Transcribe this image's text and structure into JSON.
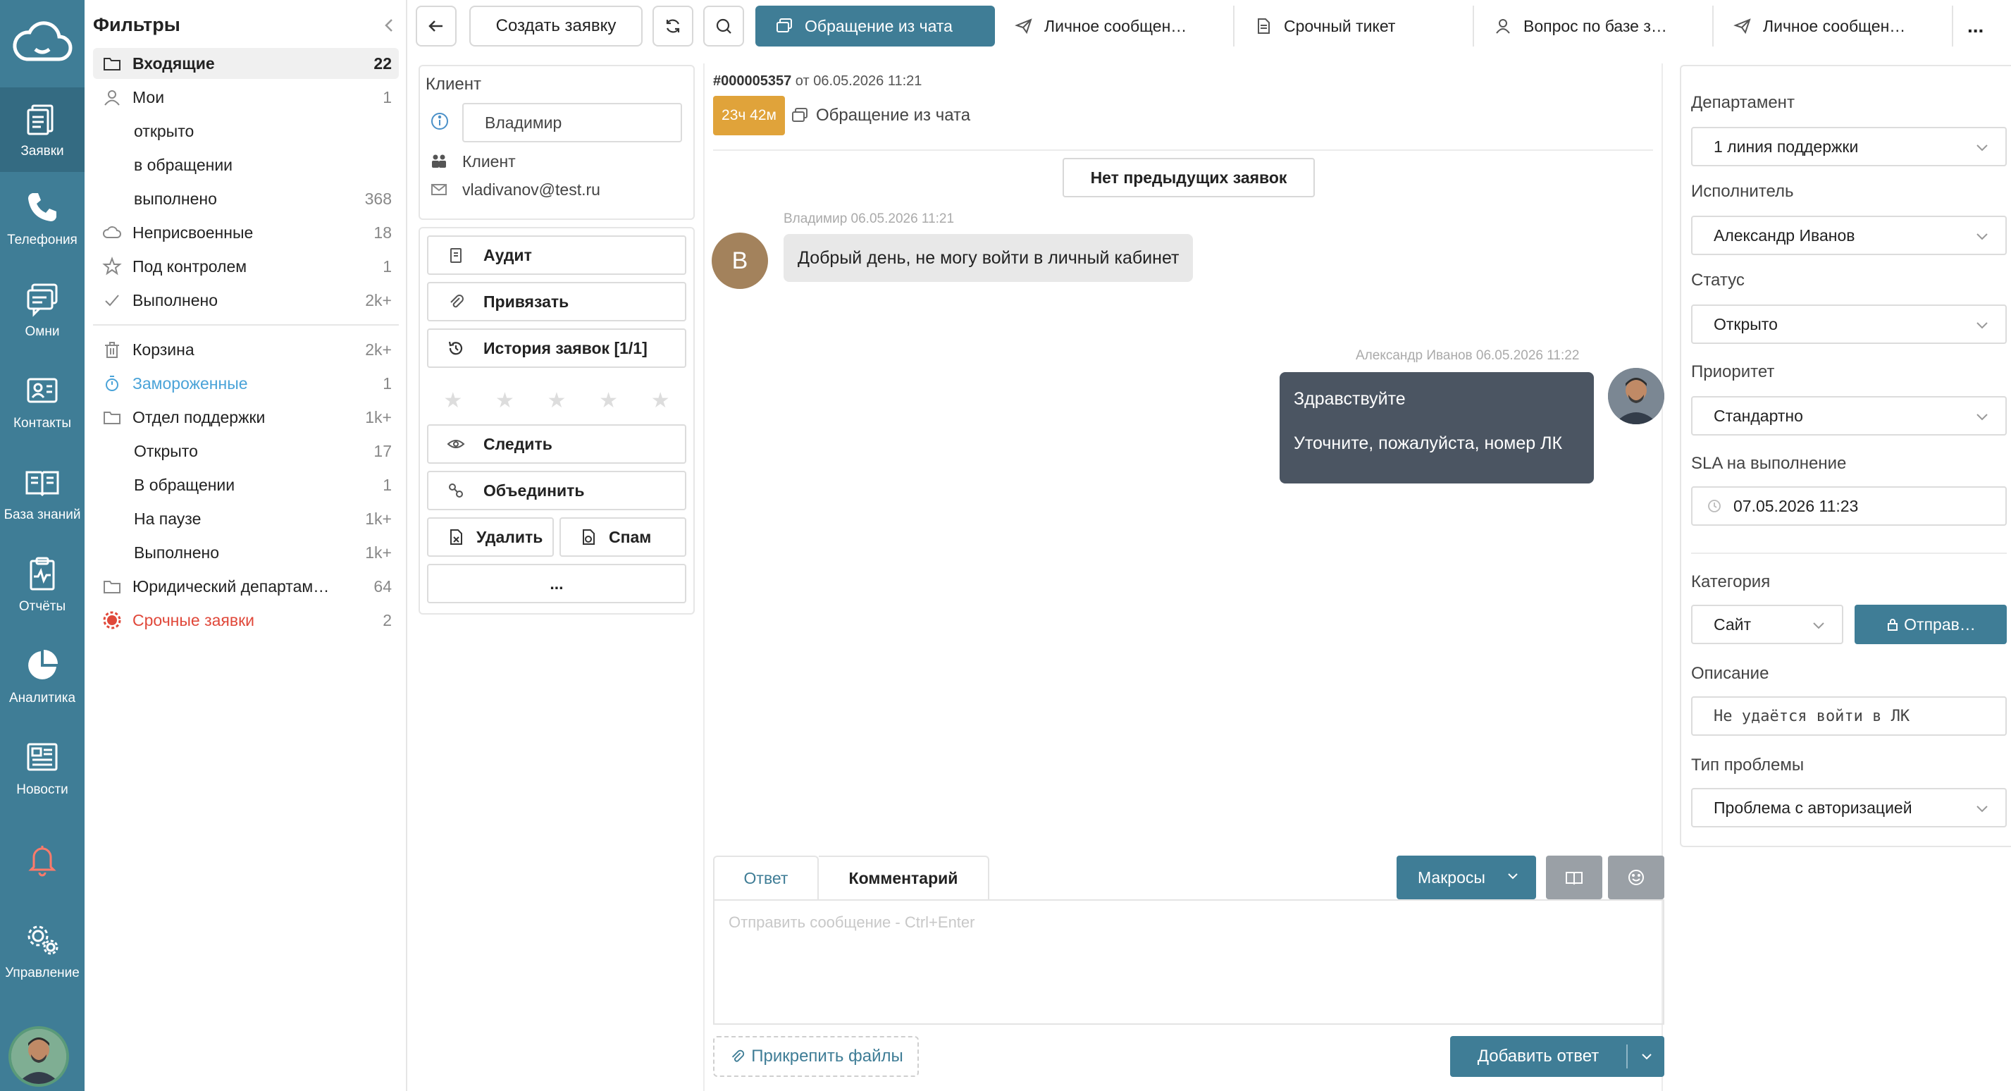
{
  "nav": {
    "items": [
      {
        "label": "Заявки",
        "icon": "tickets-icon"
      },
      {
        "label": "Телефония",
        "icon": "phone-icon"
      },
      {
        "label": "Омни",
        "icon": "omni-chat-icon"
      },
      {
        "label": "Контакты",
        "icon": "contacts-icon"
      },
      {
        "label": "База знаний",
        "icon": "knowledge-base-icon"
      },
      {
        "label": "Отчёты",
        "icon": "reports-icon"
      },
      {
        "label": "Аналитика",
        "icon": "analytics-icon"
      },
      {
        "label": "Новости",
        "icon": "news-icon"
      },
      {
        "label": "",
        "icon": "bell-icon"
      },
      {
        "label": "Управление",
        "icon": "settings-gears-icon"
      }
    ]
  },
  "filters": {
    "title": "Фильтры",
    "rows": [
      {
        "label": "Входящие",
        "count": "22"
      },
      {
        "label": "Мои",
        "count": "1"
      },
      {
        "label": "открыто",
        "count": ""
      },
      {
        "label": "в обращении",
        "count": ""
      },
      {
        "label": "выполнено",
        "count": "368"
      },
      {
        "label": "Неприсвоенные",
        "count": "18"
      },
      {
        "label": "Под контролем",
        "count": "1"
      },
      {
        "label": "Выполнено",
        "count": "2k+"
      },
      {
        "label": "Корзина",
        "count": "2k+"
      },
      {
        "label": "Замороженные",
        "count": "1"
      },
      {
        "label": "Отдел поддержки",
        "count": "1k+"
      },
      {
        "label": "Открыто",
        "count": "17"
      },
      {
        "label": "В обращении",
        "count": "1"
      },
      {
        "label": "На паузе",
        "count": "1k+"
      },
      {
        "label": "Выполнено",
        "count": "1k+"
      },
      {
        "label": "Юридический департам…",
        "count": "64"
      },
      {
        "label": "Срочные заявки",
        "count": "2"
      }
    ]
  },
  "toolbar": {
    "create_label": "Создать заявку",
    "tabs": [
      {
        "label": "Обращение из чата"
      },
      {
        "label": "Личное сообщен…"
      },
      {
        "label": "Срочный тикет"
      },
      {
        "label": "Вопрос по базе з…"
      },
      {
        "label": "Личное сообщен…"
      }
    ],
    "more_label": "..."
  },
  "client": {
    "section_label": "Клиент",
    "name_value": "Владимир",
    "type_label": "Клиент",
    "email": "vladivanov@test.ru"
  },
  "actions": {
    "audit": "Аудит",
    "link": "Привязать",
    "history": "История заявок [1/1]",
    "follow": "Следить",
    "merge": "Объединить",
    "delete": "Удалить",
    "spam": "Спам",
    "more": "..."
  },
  "ticket": {
    "number": "#000005357",
    "date_text": "от 06.05.2026 11:21",
    "sla_badge": "23ч 42м",
    "source": "Обращение из чата",
    "no_prev": "Нет предыдущих заявок"
  },
  "messages": [
    {
      "meta": "Владимир 06.05.2026 11:21",
      "avatar_letter": "В",
      "lines": [
        "Добрый день, не могу войти в личный кабинет"
      ]
    },
    {
      "meta": "Александр Иванов 06.05.2026 11:22",
      "lines": [
        "Здравствуйте",
        "Уточните, пожалуйста, номер ЛК"
      ]
    }
  ],
  "composer": {
    "tab_reply": "Ответ",
    "tab_comment": "Комментарий",
    "macros": "Макросы",
    "placeholder": "Отправить сообщение - Ctrl+Enter",
    "attach": "Прикрепить файлы",
    "submit": "Добавить ответ"
  },
  "props": {
    "department_label": "Департамент",
    "department_value": "1 линия поддержки",
    "assignee_label": "Исполнитель",
    "assignee_value": "Александр Иванов",
    "status_label": "Статус",
    "status_value": "Открыто",
    "priority_label": "Приоритет",
    "priority_value": "Стандартно",
    "sla_label": "SLA на выполнение",
    "sla_value": "07.05.2026 11:23",
    "category_label": "Категория",
    "category_value": "Сайт",
    "send_button": "Отправ…",
    "description_label": "Описание",
    "description_value": "Не удаётся войти в ЛК",
    "problem_label": "Тип проблемы",
    "problem_value": "Проблема с авторизацией"
  },
  "colors": {
    "brand": "#3f7d96",
    "sla_badge": "#e0a33a",
    "urgent": "#e0483a",
    "frozen": "#4aa3d8",
    "agent_bubble": "#4b5562"
  }
}
